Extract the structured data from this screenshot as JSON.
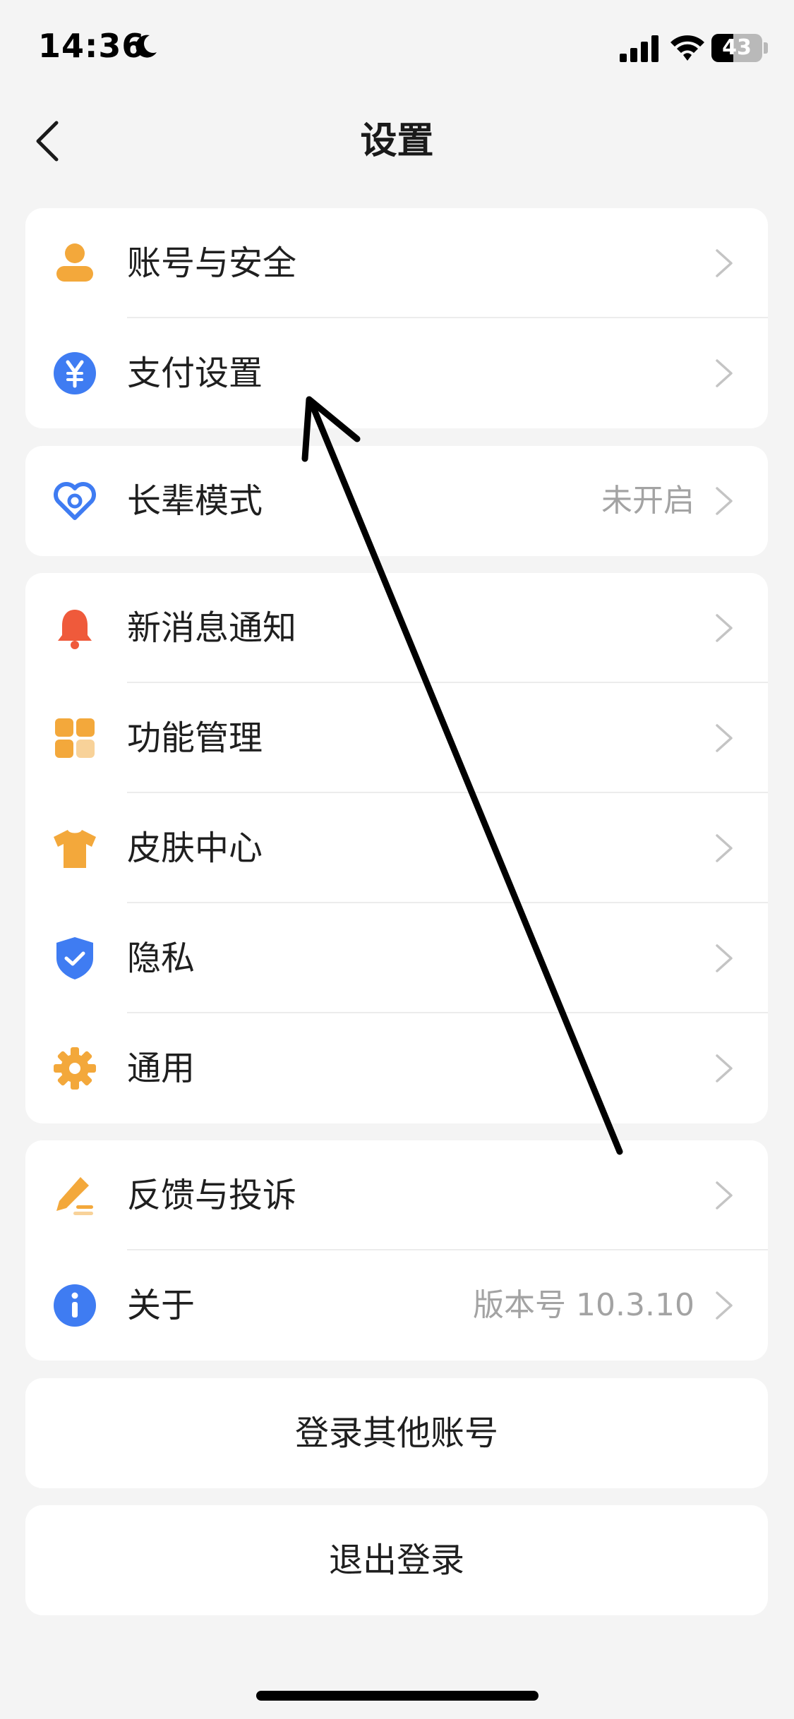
{
  "status_bar": {
    "time": "14:36",
    "battery_level": "43",
    "battery_fraction": 0.43
  },
  "nav": {
    "title": "设置",
    "back_icon": "chevron-left-icon"
  },
  "groups": [
    {
      "items": [
        {
          "label": "账号与安全",
          "value": "",
          "icon": "user-icon",
          "color": "#f3a83b"
        },
        {
          "label": "支付设置",
          "value": "",
          "icon": "yuan-icon",
          "color": "#3f7cf2"
        }
      ]
    },
    {
      "items": [
        {
          "label": "长辈模式",
          "value": "未开启",
          "icon": "heart-icon",
          "color": "#3f7cf2"
        }
      ]
    },
    {
      "items": [
        {
          "label": "新消息通知",
          "value": "",
          "icon": "bell-icon",
          "color": "#ef5a3b"
        },
        {
          "label": "功能管理",
          "value": "",
          "icon": "grid-icon",
          "color": "#f3a83b"
        },
        {
          "label": "皮肤中心",
          "value": "",
          "icon": "tshirt-icon",
          "color": "#f3a83b"
        },
        {
          "label": "隐私",
          "value": "",
          "icon": "shield-icon",
          "color": "#3f7cf2"
        },
        {
          "label": "通用",
          "value": "",
          "icon": "gear-icon",
          "color": "#f3a83b"
        }
      ]
    },
    {
      "items": [
        {
          "label": "反馈与投诉",
          "value": "",
          "icon": "pencil-icon",
          "color": "#f3a83b"
        },
        {
          "label": "关于",
          "value": "版本号 10.3.10",
          "icon": "info-icon",
          "color": "#3f7cf2"
        }
      ]
    }
  ],
  "buttons": {
    "switch_account": "登录其他账号",
    "logout": "退出登录"
  }
}
